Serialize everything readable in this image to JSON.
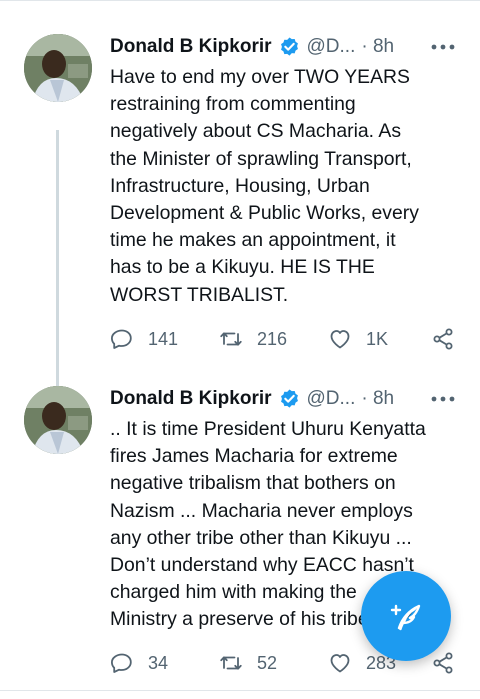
{
  "tweets": [
    {
      "name": "Donald B Kipkorir",
      "handle": "@D...",
      "time": "· 8h",
      "text": "Have to end my over TWO YEARS\nrestraining from commenting\nnegatively about CS Macharia. As\nthe Minister of sprawling Transport,\nInfrastructure, Housing, Urban\nDevelopment & Public Works, every\ntime he makes an appointment, it\nhas to be a Kikuyu. HE IS THE\nWORST TRIBALIST.",
      "replies": "141",
      "retweets": "216",
      "likes": "1K"
    },
    {
      "name": "Donald B Kipkorir",
      "handle": "@D...",
      "time": "· 8h",
      "text": ".. It is time President Uhuru Kenyatta\nfires James Macharia for extreme\nnegative tribalism that bothers on\nNazism ... Macharia never employs\nany other tribe other than Kikuyu ...\nDon’t understand why EACC hasn’t\ncharged him with making the\nMinistry a preserve of his tribe.",
      "replies": "34",
      "retweets": "52",
      "likes": "283"
    }
  ],
  "icons": {
    "verified": "verified-badge-icon",
    "more": "more-icon",
    "reply": "reply-icon",
    "retweet": "retweet-icon",
    "like": "heart-icon",
    "share": "share-icon",
    "compose": "compose-icon"
  },
  "colors": {
    "accent": "#1d9bf0",
    "text": "#0f1419",
    "secondary": "#536471",
    "divider": "#e1e6ea"
  }
}
